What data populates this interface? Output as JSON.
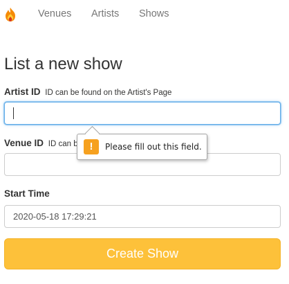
{
  "nav": {
    "brand_icon": "fire-icon",
    "links": [
      "Venues",
      "Artists",
      "Shows"
    ]
  },
  "form": {
    "title": "List a new show",
    "artist_id": {
      "label": "Artist ID",
      "hint": "ID can be found on the Artist's Page",
      "value": ""
    },
    "venue_id": {
      "label": "Venue ID",
      "hint": "ID can be",
      "value": ""
    },
    "start_time": {
      "label": "Start Time",
      "value": "2020-05-18 17:29:21"
    },
    "submit_label": "Create Show"
  },
  "validation_tooltip": {
    "icon": "warning-icon",
    "icon_glyph": "!",
    "message": "Please fill out this field."
  },
  "colors": {
    "accent": "#fdc13a",
    "focus": "#66afe9",
    "warning": "#f6a11f",
    "nav_link": "#777777"
  }
}
